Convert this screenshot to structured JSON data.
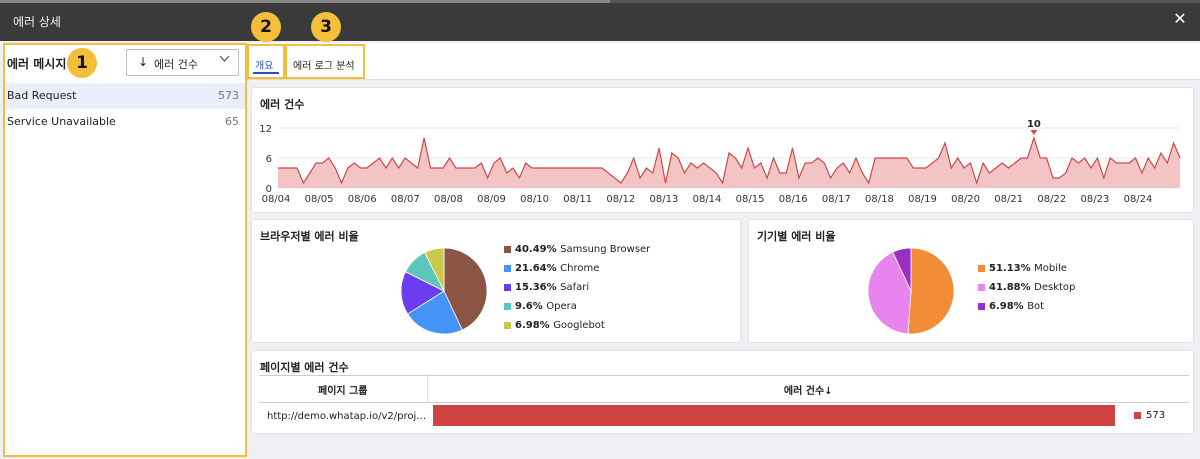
{
  "window": {
    "title": "에러 상세",
    "close_icon": "close-icon"
  },
  "left": {
    "header_label": "에러 메시지",
    "sort": {
      "arrow": "↓",
      "label": "에러 건수",
      "chevron": "﹀"
    },
    "errors": [
      {
        "name": "Bad Request",
        "count": "573"
      },
      {
        "name": "Service Unavailable",
        "count": "65"
      }
    ]
  },
  "badges": [
    "1",
    "2",
    "3"
  ],
  "tabs": [
    {
      "label": "개요"
    },
    {
      "label": "에러 로그 분석"
    }
  ],
  "error_count_chart": {
    "title": "에러 건수",
    "peak_label": "10",
    "chart_data": {
      "type": "area",
      "yticks": [
        "12",
        "6",
        "0"
      ],
      "ylim": [
        0,
        12
      ],
      "xticks": [
        "08/04",
        "08/05",
        "08/06",
        "08/07",
        "08/08",
        "08/09",
        "08/10",
        "08/11",
        "08/12",
        "08/13",
        "08/14",
        "08/15",
        "08/16",
        "08/17",
        "08/18",
        "08/19",
        "08/20",
        "08/21",
        "08/22",
        "08/23",
        "08/24"
      ],
      "color": "#d04848",
      "values": [
        4,
        4,
        4,
        4,
        1,
        3,
        5,
        5,
        6,
        4,
        1,
        4,
        5,
        4,
        4,
        5,
        6,
        4,
        6,
        4,
        6,
        5,
        4,
        10,
        4,
        4,
        4,
        6,
        4,
        4,
        4,
        4,
        5,
        2,
        5,
        6,
        3,
        4,
        2,
        5,
        4,
        4,
        4,
        4,
        4,
        4,
        4,
        4,
        4,
        4,
        4,
        4,
        3,
        2,
        1,
        3,
        6,
        2,
        4,
        3,
        8,
        1,
        7,
        6,
        3,
        5,
        4,
        5,
        4,
        3,
        1,
        7,
        6,
        4,
        8,
        4,
        5,
        2,
        6,
        3,
        3,
        8,
        2,
        5,
        5,
        6,
        5,
        2,
        4,
        5,
        3,
        6,
        3,
        1,
        6,
        6,
        6,
        6,
        6,
        6,
        4,
        4,
        4,
        5,
        6,
        9,
        4,
        6,
        4,
        5,
        1,
        5,
        3,
        4,
        5,
        4,
        5,
        6,
        6,
        10,
        6,
        6,
        2,
        2,
        3,
        6,
        5,
        6,
        4,
        6,
        2,
        6,
        5,
        5,
        5,
        6,
        3,
        6,
        4,
        7,
        5,
        9,
        6
      ]
    }
  },
  "browser_chart": {
    "title": "브라우저별 에러 비율",
    "chart_data": {
      "type": "pie",
      "slices": [
        {
          "label": "Samsung Browser",
          "pct_text": "40.49%",
          "value": 40.49,
          "color": "#8b5443"
        },
        {
          "label": "Chrome",
          "pct_text": "21.64%",
          "value": 21.64,
          "color": "#4593f6"
        },
        {
          "label": "Safari",
          "pct_text": "15.36%",
          "value": 15.36,
          "color": "#6b3cf0"
        },
        {
          "label": "Opera",
          "pct_text": "9.6%",
          "value": 9.6,
          "color": "#5cc6bd"
        },
        {
          "label": "Googlebot",
          "pct_text": "6.98%",
          "value": 6.98,
          "color": "#c9c94b"
        }
      ]
    }
  },
  "device_chart": {
    "title": "기기별 에러 비율",
    "chart_data": {
      "type": "pie",
      "slices": [
        {
          "label": "Mobile",
          "pct_text": "51.13%",
          "value": 51.13,
          "color": "#f28c37"
        },
        {
          "label": "Desktop",
          "pct_text": "41.88%",
          "value": 41.88,
          "color": "#e784ee"
        },
        {
          "label": "Bot",
          "pct_text": "6.98%",
          "value": 6.98,
          "color": "#9b2fc0"
        }
      ]
    }
  },
  "page_table": {
    "title": "페이지별 에러 건수",
    "col_group": "페이지 그룹",
    "col_count": "에러 건수↓",
    "rows": [
      {
        "page": "http://demo.whatap.io/v2/projec...",
        "count": "573",
        "value": 573
      }
    ],
    "bar_color": "#cf4343"
  }
}
